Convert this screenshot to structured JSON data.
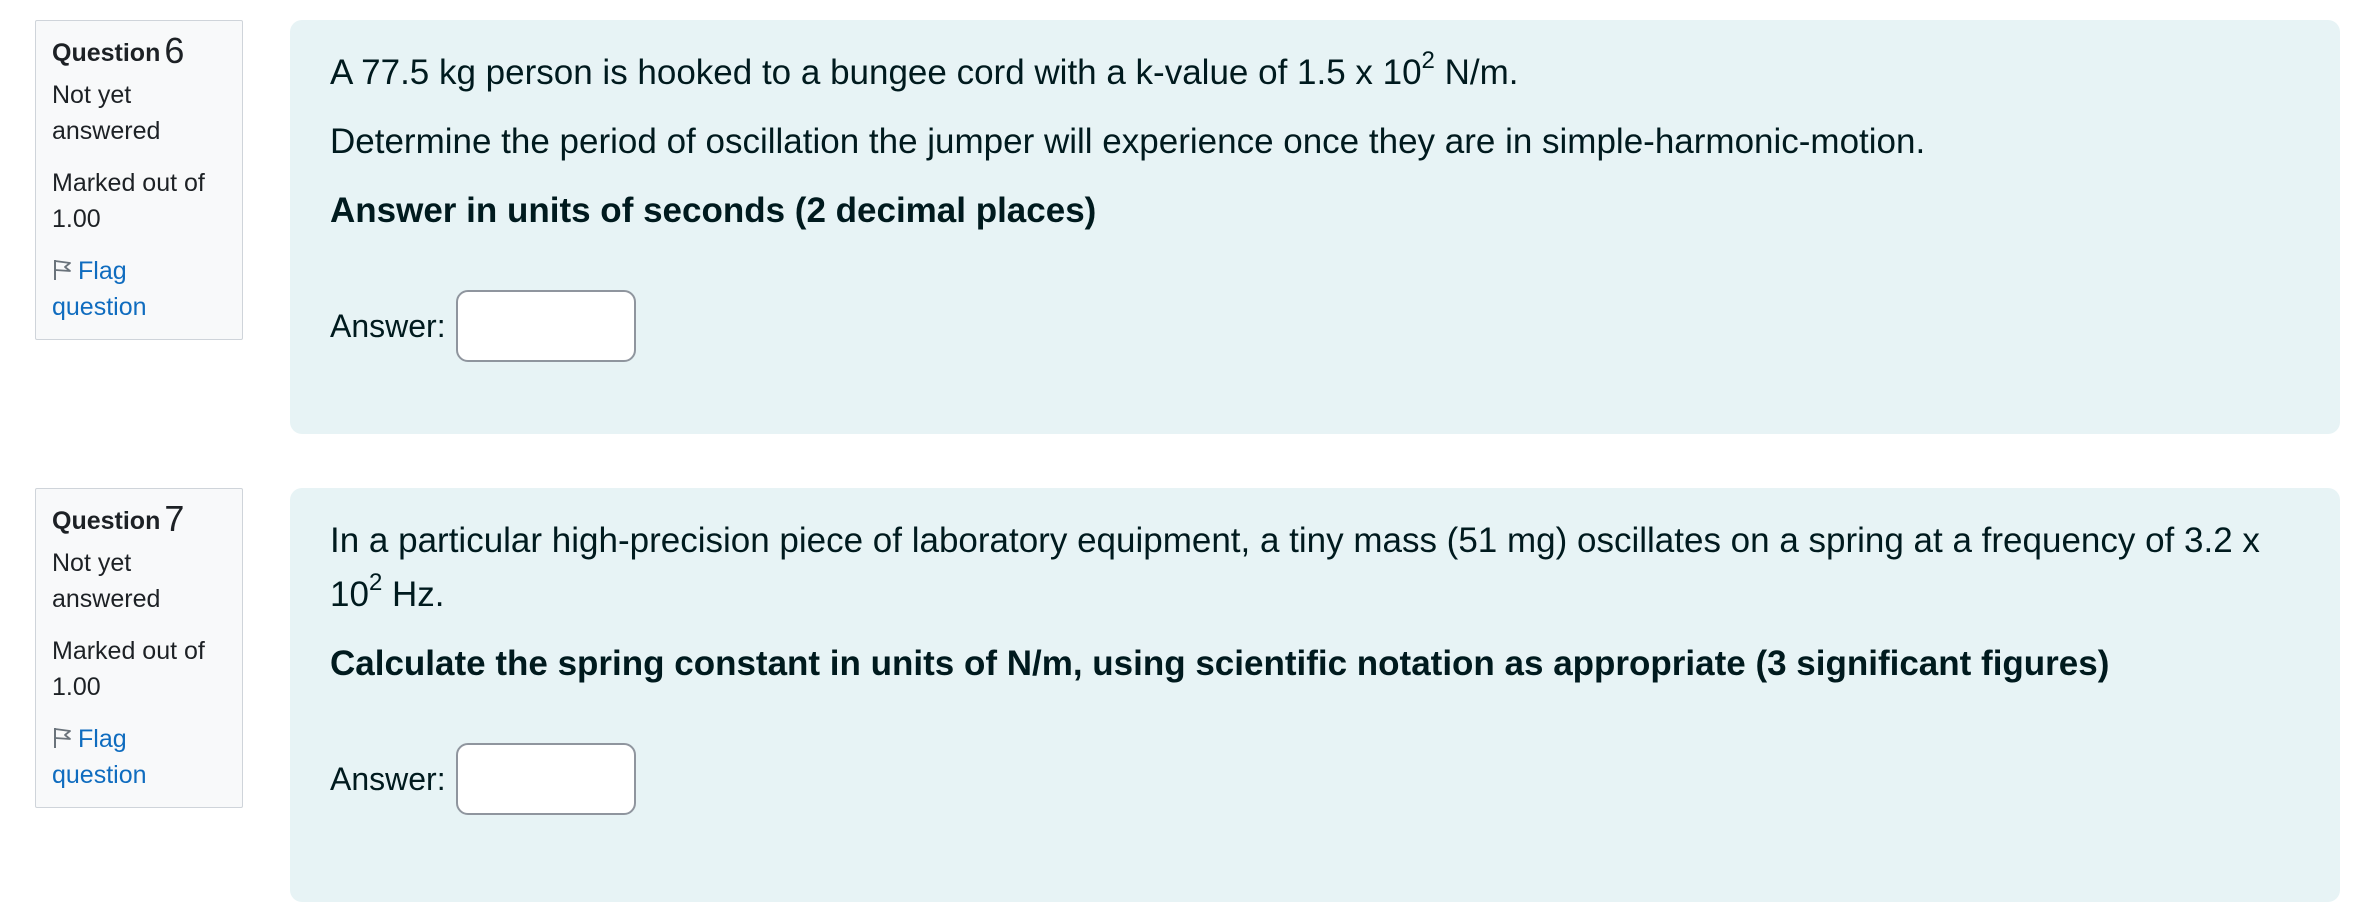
{
  "questions": [
    {
      "label": "Question",
      "number": "6",
      "state": "Not yet answered",
      "grade": "Marked out of 1.00",
      "flag_label": "Flag question",
      "text1_a": "A 77.5 kg person is hooked to a bungee cord with a k-value of 1.5 x 10",
      "text1_sup": "2",
      "text1_b": " N/m.",
      "text2": "Determine the period of oscillation the jumper will experience once they are in simple-harmonic-motion.",
      "instruction": "Answer in units of seconds (2 decimal places)",
      "answer_label": "Answer:",
      "answer_value": ""
    },
    {
      "label": "Question",
      "number": "7",
      "state": "Not yet answered",
      "grade": "Marked out of 1.00",
      "flag_label": "Flag question",
      "text1_a": "In a particular high-precision piece of laboratory equipment, a tiny mass (51 mg) oscillates on a spring at a frequency of 3.2 x 10",
      "text1_sup": "2",
      "text1_b": " Hz.",
      "instruction": "Calculate the spring constant in units of N/m, using scientific notation as appropriate (3 significant figures)",
      "answer_label": "Answer:",
      "answer_value": ""
    }
  ],
  "colors": {
    "content_bg": "#e7f3f5",
    "info_bg": "#f8f9fa",
    "link": "#0f6cbf",
    "text": "#001a1e"
  }
}
